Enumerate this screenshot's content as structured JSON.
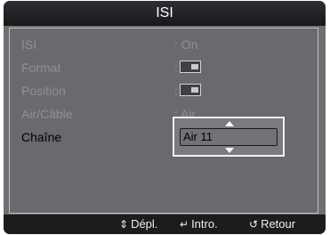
{
  "title": "ISI",
  "menu": [
    {
      "label": "ISI",
      "value": ": On",
      "value_type": "text",
      "active": false
    },
    {
      "label": "Format",
      "value": ":",
      "value_type": "icon",
      "icon": "picture-format-icon",
      "active": false
    },
    {
      "label": "Position",
      "value": ":",
      "value_type": "icon",
      "icon": "picture-position-icon",
      "active": false
    },
    {
      "label": "Air/Câble",
      "value": ": Air",
      "value_type": "text",
      "active": false
    },
    {
      "label": "Chaîne",
      "value": ":",
      "value_type": "text",
      "active": true
    }
  ],
  "channel_popup": {
    "selected": "Air 11",
    "up_icon": "arrow-up-icon",
    "down_icon": "arrow-down-icon"
  },
  "footer": {
    "move": {
      "icon": "updown-arrow-icon",
      "glyph": "⇕",
      "label": "Dépl."
    },
    "enter": {
      "icon": "enter-icon",
      "glyph": "↵",
      "label": "Intro."
    },
    "return": {
      "icon": "return-icon",
      "glyph": "↺",
      "label": "Retour"
    }
  }
}
